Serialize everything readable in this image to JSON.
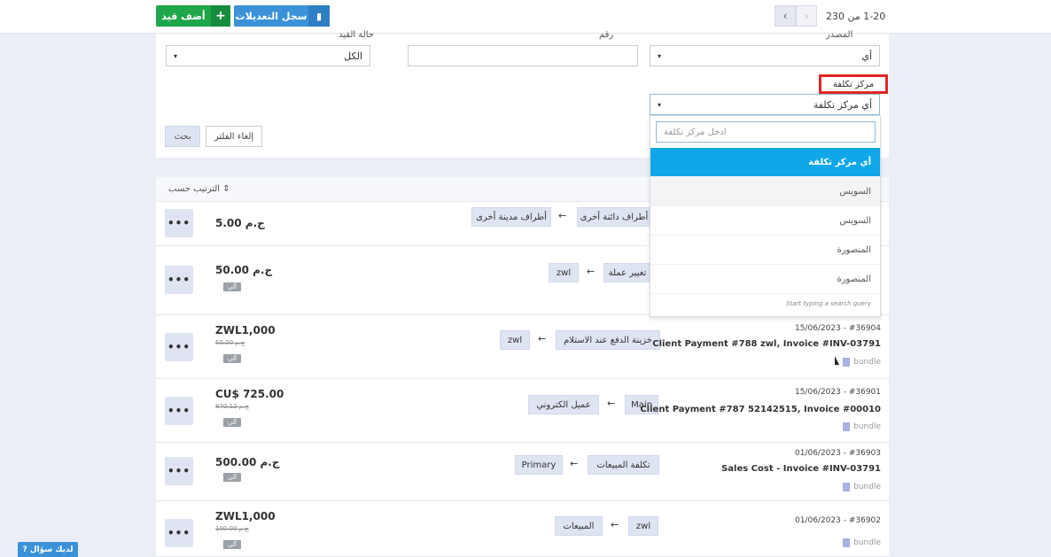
{
  "toolbar": {
    "add_label": "أضف قيد",
    "add_icon": "plus-icon",
    "log_label": "سجل التعديلات",
    "log_icon": "book-icon",
    "pager_text": "1-20  من 230"
  },
  "filters": {
    "source_label": "المصدر",
    "source_value": "أي",
    "number_label": "رقم",
    "number_value": "",
    "status_label": "حالة القيد",
    "status_value": "الكل",
    "cost_center_label": "مركز تكلفة",
    "cost_center_value": "أي مركز تكلفة",
    "search_button": "بحث",
    "cancel_button": "إلغاء الفلتر"
  },
  "dropdown": {
    "placeholder": "ادخل مركز تكلفة",
    "items": [
      "أي مركز تكلفة",
      "السويس",
      "السويس",
      "المنصورة",
      "المنصورة"
    ],
    "hint": "Start typing a search query"
  },
  "results": {
    "sort_label": "الترتيب حسب",
    "rows": [
      {
        "amount": "5.00 ج.م",
        "old_amount": "",
        "badge": "",
        "from": "أطراف مدينة أخرى",
        "to": "أطراف دائنة أخرى",
        "meta": "",
        "title": "",
        "tag": ""
      },
      {
        "amount": "50.00 ج.م",
        "old_amount": "",
        "badge": "آلي",
        "from": "تغيير عملة",
        "to": "zwl",
        "meta": "",
        "title": "",
        "tag": ""
      },
      {
        "amount": "ZWL1,000",
        "old_amount": "50.00 ج.م",
        "badge": "آلي",
        "from": "خزينة الدفع عند الاستلام",
        "to": "zwl",
        "meta": "15/06/2023 - #36904",
        "title": "Client Payment #788 zwl, Invoice #INV-03791",
        "tag": "bundle"
      },
      {
        "amount": "CU$ 725.00",
        "old_amount": "870.12 ج.م",
        "badge": "آلي",
        "from": "عميل الكتروني",
        "to": "Main",
        "meta": "15/06/2023 - #36901",
        "title": "Client Payment #787 52142515, Invoice #00010",
        "tag": "bundle"
      },
      {
        "amount": "500.00 ج.م",
        "old_amount": "",
        "badge": "آلي",
        "from": "تكلفة المبيعات",
        "to": "Primary",
        "meta": "01/06/2023 - #36903",
        "title": "Sales Cost - Invoice #INV-03791",
        "tag": "bundle"
      },
      {
        "amount": "ZWL1,000",
        "old_amount": "100.00 ج.م",
        "badge": "آلي",
        "from": "zwl",
        "to": "المبيعات",
        "meta": "01/06/2023 - #36902",
        "title": "",
        "tag": "bundle"
      }
    ]
  },
  "help": {
    "label": "لديك سؤال",
    "icon": "question-icon"
  },
  "colors": {
    "accent": "#0fa7e7",
    "green": "#1fa64a",
    "blue": "#3b91d8",
    "highlight": "#e32526"
  }
}
